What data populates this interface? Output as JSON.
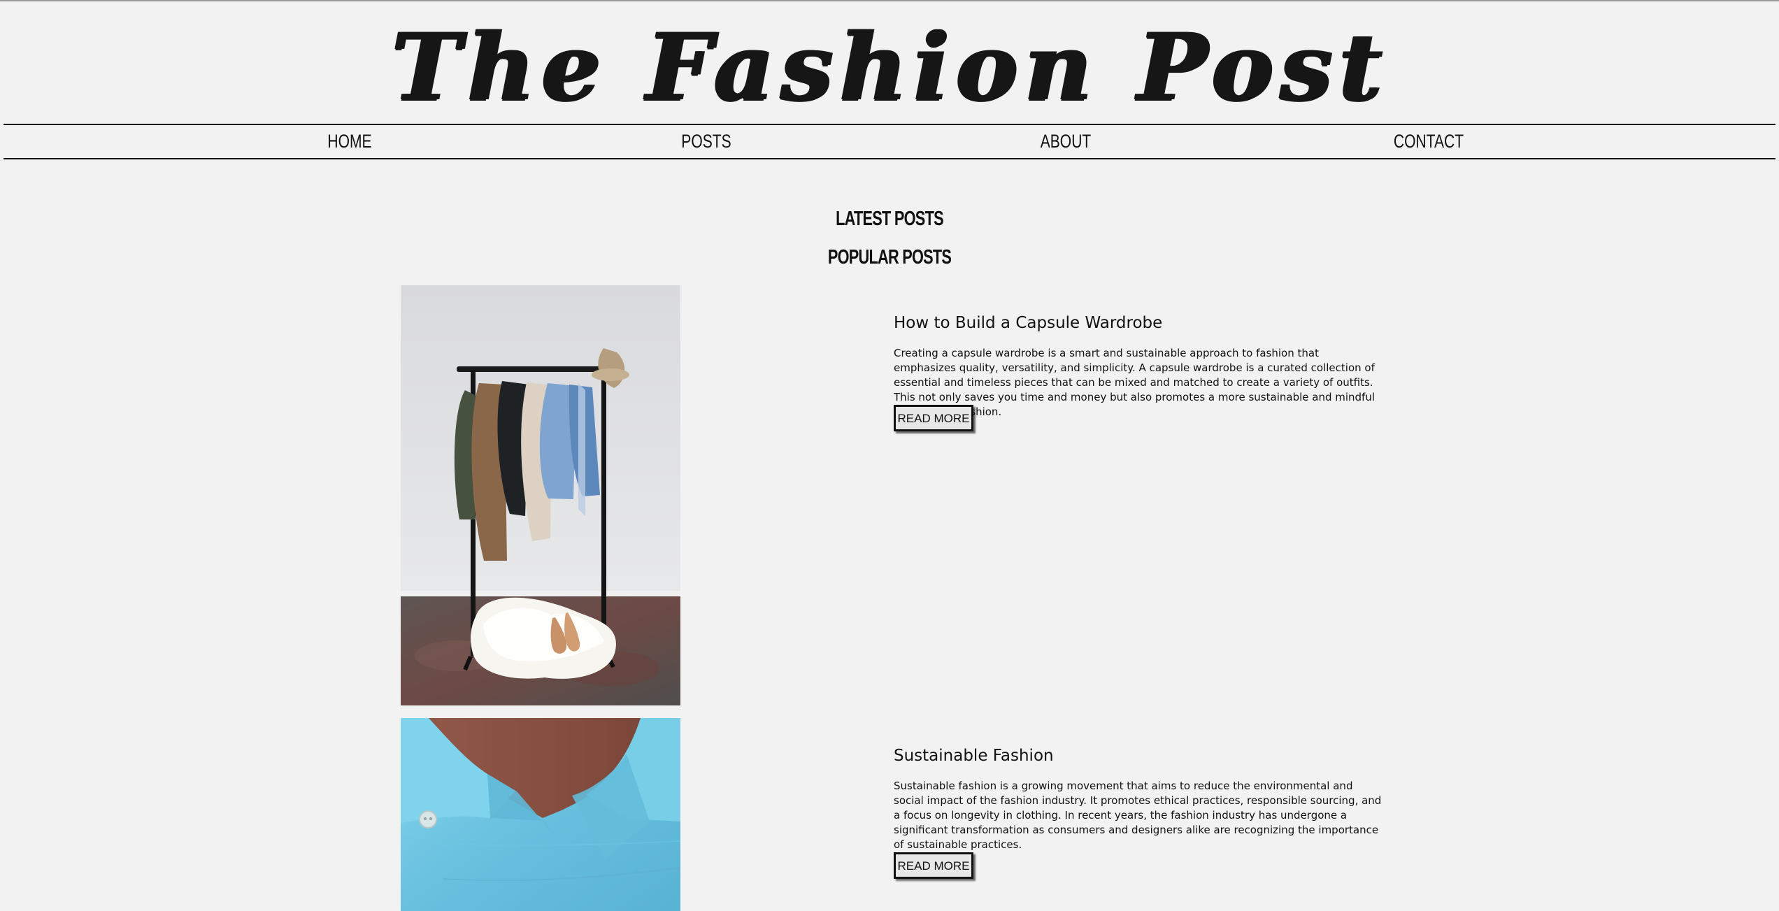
{
  "site": {
    "title": "The Fashion Post"
  },
  "nav": {
    "items": [
      {
        "label": "HOME"
      },
      {
        "label": "POSTS"
      },
      {
        "label": "ABOUT"
      },
      {
        "label": "CONTACT"
      }
    ]
  },
  "sections": {
    "latest": "LATEST POSTS",
    "popular": "POPULAR POSTS"
  },
  "posts": [
    {
      "title": "How to Build a Capsule Wardrobe",
      "body": "Creating a capsule wardrobe is a smart and sustainable approach to fashion that emphasizes quality, versatility, and simplicity. A capsule wardrobe is a curated collection of essential and timeless pieces that can be mixed and matched to create a variety of outfits. This not only saves you time and money but also promotes a more sustainable and mindful approach to fashion.",
      "button": "READ MORE",
      "image": "clothing-rack-photo"
    },
    {
      "title": "Sustainable Fashion",
      "body": "Sustainable fashion is a growing movement that aims to reduce the environmental and social impact of the fashion industry. It promotes ethical practices, responsible sourcing, and a focus on longevity in clothing. In recent years, the fashion industry has undergone a significant transformation as consumers and designers alike are recognizing the importance of sustainable practices.",
      "button": "READ MORE",
      "image": "blue-shirt-photo"
    }
  ],
  "colors": {
    "background": "#f2f2f2",
    "text": "#111111",
    "button_background": "#e7e7e7",
    "shirt_blue": "#73c8e4"
  }
}
